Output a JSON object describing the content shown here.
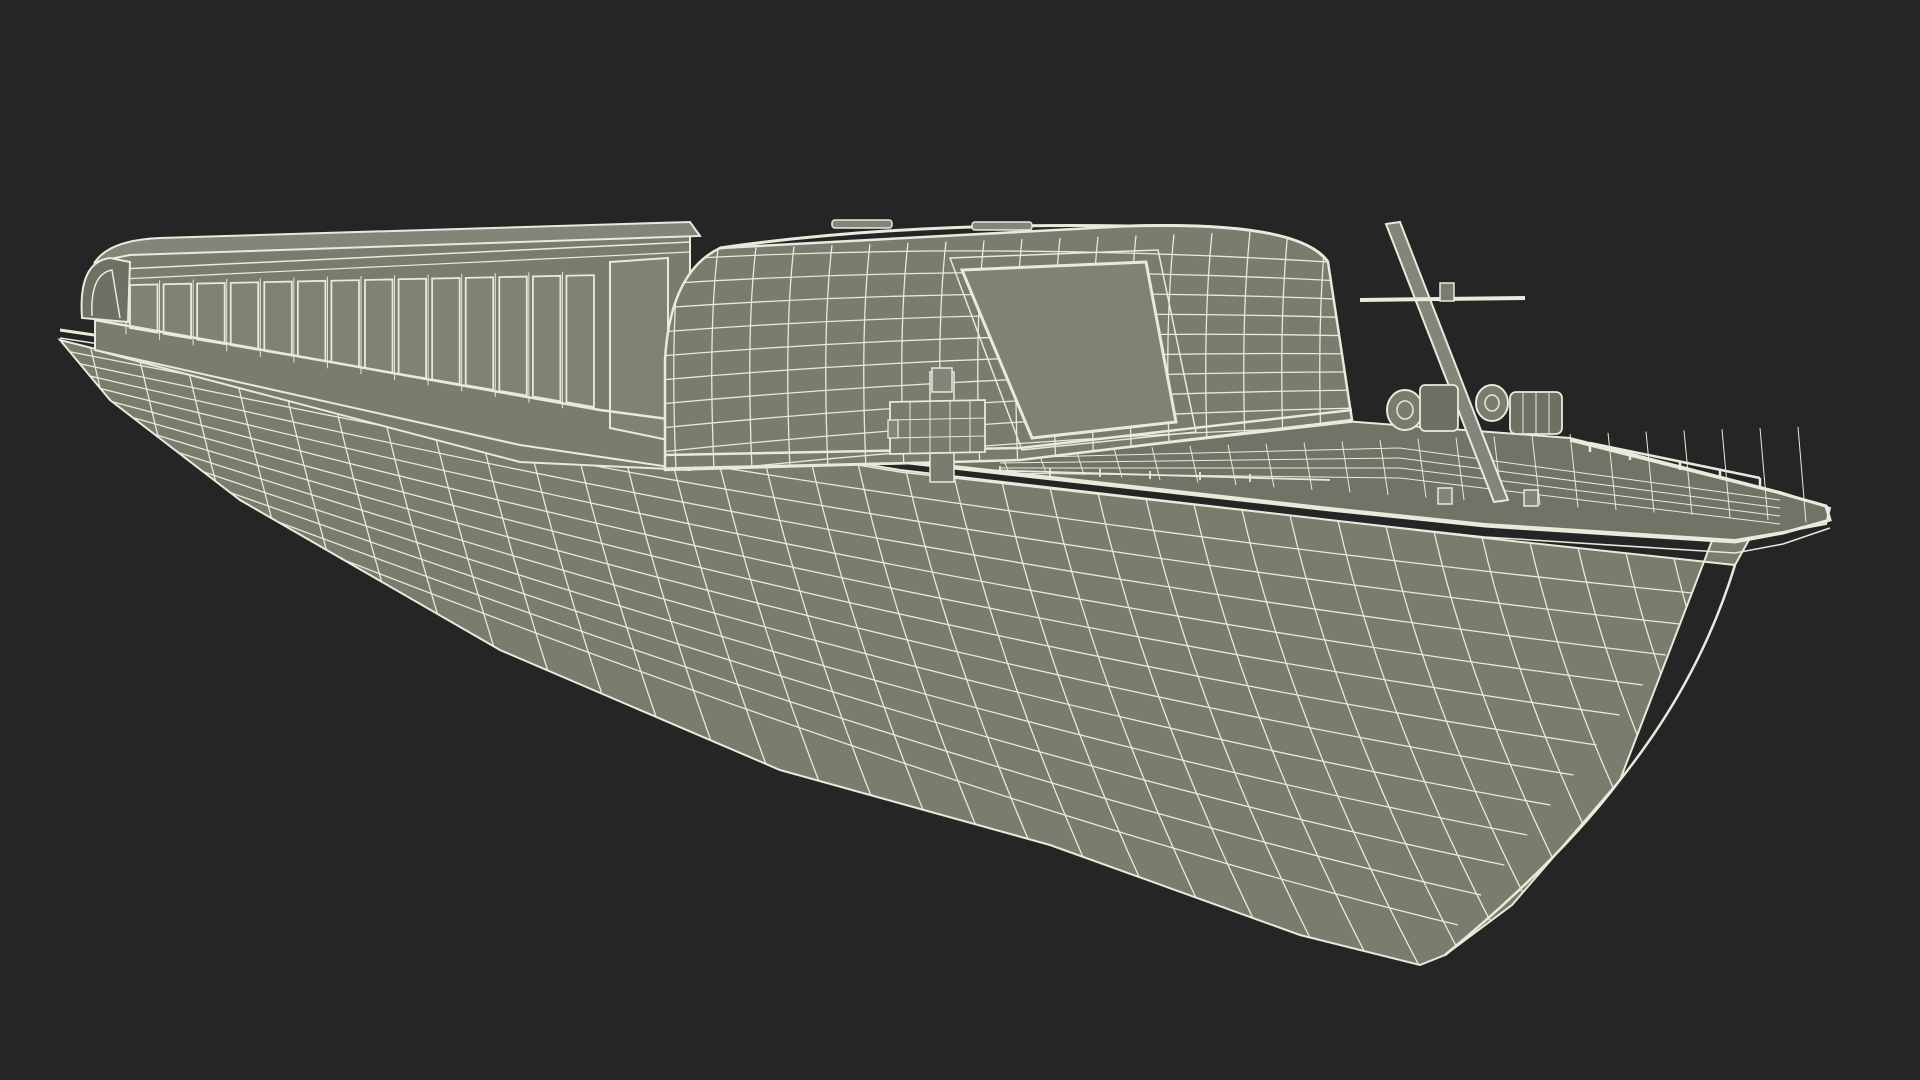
{
  "scene": {
    "background_color": "#252525",
    "model_fill_color": "#7b7c6d",
    "model_dark_fill_color": "#6f7063",
    "glass_fill_color": "#818272",
    "wire_color": "#e9e9dc",
    "subject": "canal-tour-boat-wireframe",
    "view": "front-three-quarter-perspective"
  }
}
